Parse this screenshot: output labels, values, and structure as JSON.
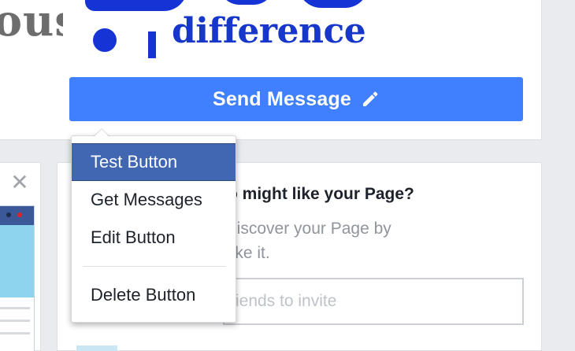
{
  "header": {
    "cover_partial_text": "ous",
    "cover_word": "difference",
    "send_message_label": "Send Message",
    "send_message_icon": "pencil-icon"
  },
  "left_card": {
    "close_icon": "close-icon"
  },
  "invite_card": {
    "title": "o might like your Page?",
    "description": "discover your Page by like it.",
    "description_line1": "discover your Page by",
    "description_line2": "like it.",
    "input_placeholder": "iends to invite"
  },
  "menu": {
    "items": [
      {
        "label": "Test Button",
        "active": true
      },
      {
        "label": "Get Messages",
        "active": false
      },
      {
        "label": "Edit Button",
        "active": false
      },
      {
        "label": "Delete Button",
        "active": false
      }
    ]
  },
  "colors": {
    "button_blue": "#4080ff",
    "menu_active": "#4267b2",
    "page_bg": "#e9ebee",
    "cover_blue": "#1637c9"
  }
}
